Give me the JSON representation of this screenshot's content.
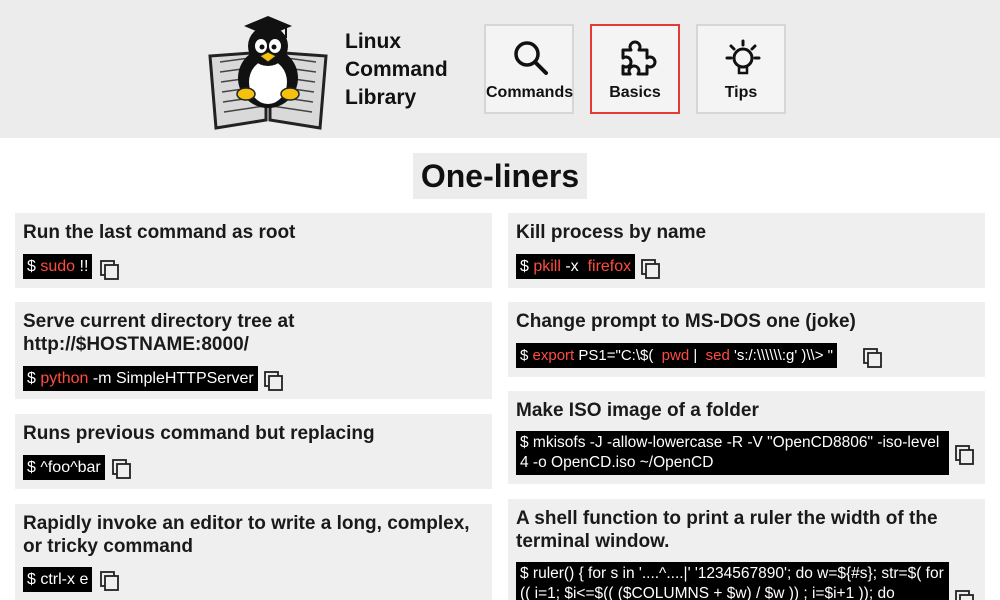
{
  "app": {
    "title_lines": [
      "Linux",
      "Command",
      "Library"
    ]
  },
  "nav": [
    {
      "label": "Commands",
      "icon": "search-icon",
      "active": false
    },
    {
      "label": "Basics",
      "icon": "puzzle-icon",
      "active": true
    },
    {
      "label": "Tips",
      "icon": "lightbulb-icon",
      "active": false
    }
  ],
  "section": {
    "title": "One-liners"
  },
  "colors": {
    "accent": "#e53935",
    "keyword": "#ff4d3d",
    "card_bg": "#efefef",
    "header_bg": "#ececec"
  },
  "cards": {
    "c1": {
      "title": "Run the last command as root",
      "cmd": {
        "p0": "$ ",
        "k1": "sudo",
        "p2": " !!"
      }
    },
    "c2": {
      "title": "Serve current directory tree at http://$HOSTNAME:8000/",
      "cmd": {
        "p0": "$ ",
        "k1": "python",
        "p2": " -m SimpleHTTPServer"
      }
    },
    "c3": {
      "title": "Runs previous command but replacing",
      "cmd": {
        "p0": "$ ^foo^bar"
      }
    },
    "c4": {
      "title": "Rapidly invoke an editor to write a long, complex, or tricky command",
      "cmd": {
        "p0": "$ ctrl-x e"
      }
    },
    "c5": {
      "title": "Kill process by name",
      "cmd": {
        "p0": "$ ",
        "k1": "pkill",
        "p2": " -x  ",
        "k3": "firefox"
      }
    },
    "c6": {
      "title": "Change prompt to MS-DOS one (joke)",
      "cmd": {
        "p0": "$ ",
        "k1": "export",
        "p2": " PS1=\"C:\\$(  ",
        "k3": "pwd",
        "p4": " |  ",
        "k5": "sed",
        "p6": " 's:/:\\\\\\\\\\\\:g' )\\\\> \""
      }
    },
    "c7": {
      "title": "Make ISO image of a folder",
      "cmd": {
        "p0": "$ mkisofs -J -allow-lowercase -R -V \"OpenCD8806\" -iso-level 4 -o OpenCD.iso ~/OpenCD"
      }
    },
    "c8": {
      "title": "A shell function to print a ruler the width of the terminal window.",
      "cmd": {
        "p0": "$ ruler() { for s in '....^....|' '1234567890'; do w=${#s}; str=$( for (( i=1; $i<=$(( ($COLUMNS + $w) / $w )) ; i=$i+1 )); do"
      }
    }
  }
}
